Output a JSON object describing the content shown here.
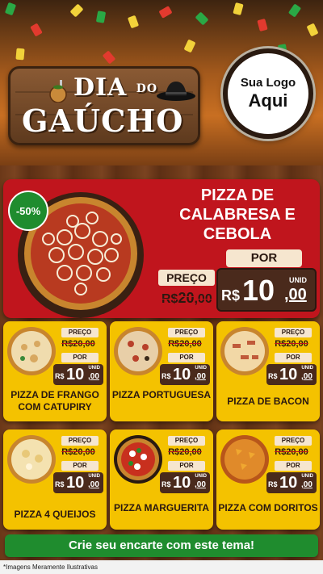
{
  "header": {
    "logo": {
      "line1": "DIA",
      "line1_small": "DO",
      "line2": "GAÚCHO",
      "gourd_icon": "chimarrao-gourd-icon",
      "hat_icon": "gaucho-hat-icon"
    },
    "brand": {
      "line1": "Sua Logo",
      "line2": "Aqui"
    }
  },
  "featured": {
    "discount": "-50%",
    "title": "PIZZA DE CALABRESA E CEBOLA",
    "por_label": "POR",
    "preco_label": "PREÇO",
    "old_price": {
      "currency": "R$",
      "int": "20",
      "dec": ",00"
    },
    "price": {
      "unid": "UNID",
      "currency": "R$",
      "int": "10",
      "dec": ",00"
    }
  },
  "products": [
    {
      "name": "PIZZA DE FRANGO COM CATUPIRY",
      "preco_label": "PREÇO",
      "old_price": "R$20,00",
      "por_label": "POR",
      "unid": "UNID",
      "currency": "R$",
      "int": "10",
      "dec": ",00"
    },
    {
      "name": "PIZZA PORTUGUESA",
      "preco_label": "PREÇO",
      "old_price": "R$20,00",
      "por_label": "POR",
      "unid": "UNID",
      "currency": "R$",
      "int": "10",
      "dec": ",00"
    },
    {
      "name": "PIZZA DE BACON",
      "preco_label": "PREÇO",
      "old_price": "R$20,00",
      "por_label": "POR",
      "unid": "UNID",
      "currency": "R$",
      "int": "10",
      "dec": ",00"
    },
    {
      "name": "PIZZA 4 QUEIJOS",
      "preco_label": "PREÇO",
      "old_price": "R$20,00",
      "por_label": "POR",
      "unid": "UNID",
      "currency": "R$",
      "int": "10",
      "dec": ",00"
    },
    {
      "name": "PIZZA MARGUERITA",
      "preco_label": "PREÇO",
      "old_price": "R$20,00",
      "por_label": "POR",
      "unid": "UNID",
      "currency": "R$",
      "int": "10",
      "dec": ",00"
    },
    {
      "name": "PIZZA COM DORITOS",
      "preco_label": "PREÇO",
      "old_price": "R$20,00",
      "por_label": "POR",
      "unid": "UNID",
      "currency": "R$",
      "int": "10",
      "dec": ",00"
    }
  ],
  "cta": "Crie seu encarte com este tema!",
  "disclaimer": "*Imagens Meramente Ilustrativas",
  "colors": {
    "featured_bg": "#c0151d",
    "card_bg": "#f4c200",
    "cta_bg": "#1f8c2e",
    "price_box": "#4a2a1c"
  }
}
